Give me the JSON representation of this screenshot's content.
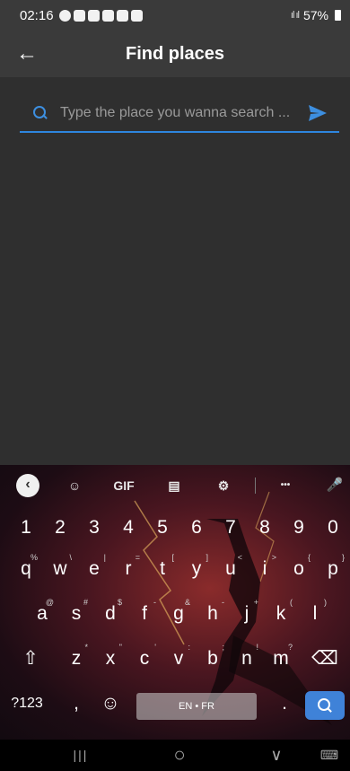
{
  "status_bar": {
    "time": "02:16",
    "battery": "57%",
    "signal": "ıl ıl",
    "icons": [
      "whatsapp-icon",
      "snapchat-icon",
      "snapchat-icon",
      "notification-icon",
      "gallery-icon",
      "snapchat-icon"
    ]
  },
  "app_bar": {
    "back_icon": "←",
    "title": "Find places"
  },
  "search": {
    "value": "",
    "placeholder": "Type the place you wanna search ...",
    "accent_color": "#2e86de"
  },
  "keyboard": {
    "toolbar": {
      "back": "‹",
      "sticker": "☺",
      "gif": "GIF",
      "clipboard": "▤",
      "settings": "⚙",
      "more": "•••",
      "mic": "🎤"
    },
    "number_row": [
      "1",
      "2",
      "3",
      "4",
      "5",
      "6",
      "7",
      "8",
      "9",
      "0"
    ],
    "row1": [
      {
        "key": "q",
        "hint": "%"
      },
      {
        "key": "w",
        "hint": "\\"
      },
      {
        "key": "e",
        "hint": "|"
      },
      {
        "key": "r",
        "hint": "="
      },
      {
        "key": "t",
        "hint": "["
      },
      {
        "key": "y",
        "hint": "]"
      },
      {
        "key": "u",
        "hint": "<"
      },
      {
        "key": "i",
        "hint": ">"
      },
      {
        "key": "o",
        "hint": "{"
      },
      {
        "key": "p",
        "hint": "}"
      }
    ],
    "row2": [
      {
        "key": "a",
        "hint": "@"
      },
      {
        "key": "s",
        "hint": "#"
      },
      {
        "key": "d",
        "hint": "$"
      },
      {
        "key": "f",
        "hint": "-"
      },
      {
        "key": "g",
        "hint": "&"
      },
      {
        "key": "h",
        "hint": "-"
      },
      {
        "key": "j",
        "hint": "+"
      },
      {
        "key": "k",
        "hint": "("
      },
      {
        "key": "l",
        "hint": ")"
      }
    ],
    "row3": [
      {
        "key": "z",
        "hint": "*"
      },
      {
        "key": "x",
        "hint": "\""
      },
      {
        "key": "c",
        "hint": "'"
      },
      {
        "key": "v",
        "hint": ":"
      },
      {
        "key": "b",
        "hint": ";"
      },
      {
        "key": "n",
        "hint": "!"
      },
      {
        "key": "m",
        "hint": "?"
      }
    ],
    "shift": "⇧",
    "backspace": "⌫",
    "symbols": "?123",
    "comma": ",",
    "emoji": "☺",
    "space_label": "EN • FR",
    "period": "."
  },
  "nav_bar": {
    "recents": "|||",
    "home": "○",
    "back": "∨",
    "keyboard": "⌨"
  }
}
